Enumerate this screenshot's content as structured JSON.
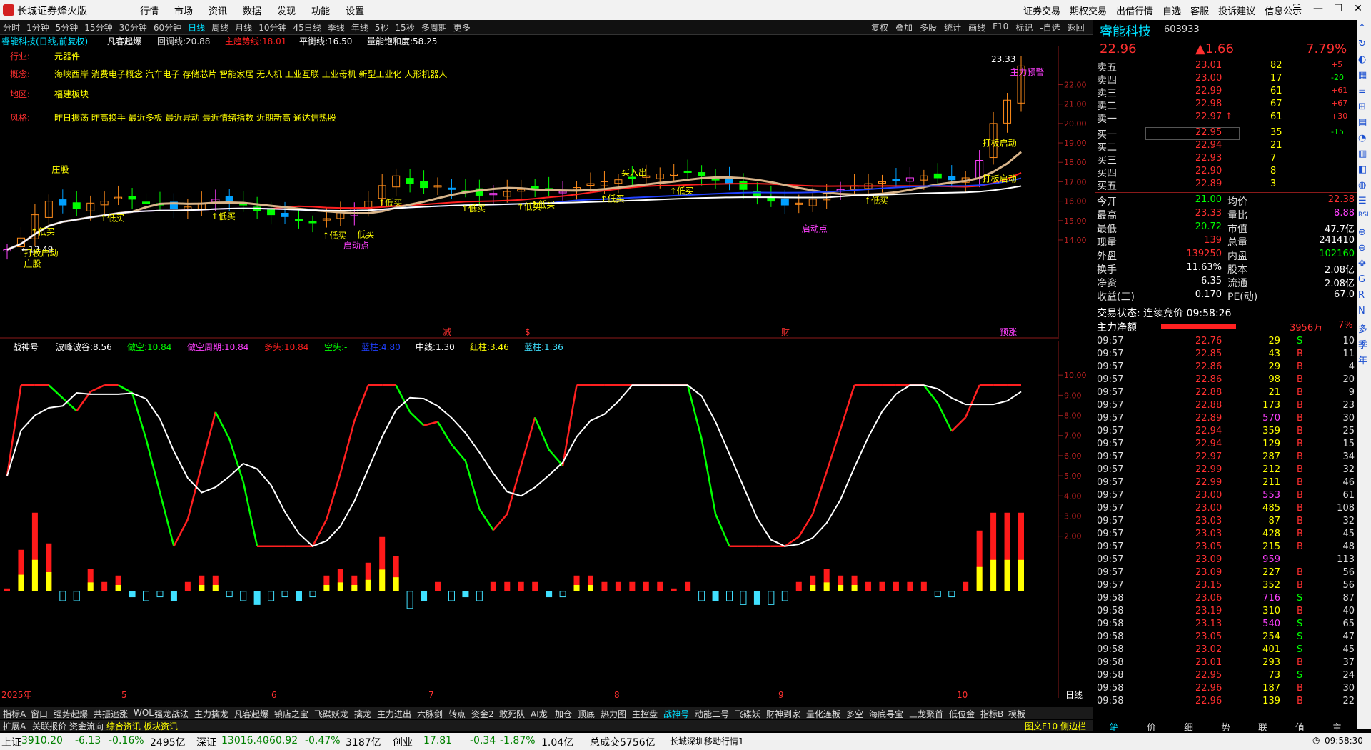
{
  "window": {
    "title": "长城证券烽火版",
    "menu": [
      "行情",
      "市场",
      "资讯",
      "数据",
      "发现",
      "功能",
      "设置"
    ],
    "right_menu": [
      "证券交易",
      "期权交易",
      "出借行情",
      "自选",
      "客服",
      "投诉建议",
      "信息公示"
    ]
  },
  "period_bar": {
    "items": [
      "分时",
      "1分钟",
      "5分钟",
      "15分钟",
      "30分钟",
      "60分钟",
      "日线",
      "周线",
      "月线",
      "10分钟",
      "45日线",
      "季线",
      "年线",
      "5秒",
      "15秒",
      "多周期",
      "更多"
    ],
    "active": "日线",
    "tools": [
      "复权",
      "叠加",
      "多股",
      "统计",
      "画线",
      "F10",
      "标记",
      "-自选",
      "返回"
    ]
  },
  "chart_header": {
    "stock": "睿能科技(日线,前复权)",
    "indicator": "凡客起爆",
    "items": [
      {
        "label": "回调线:",
        "value": "20.88",
        "color": "#dddddd"
      },
      {
        "label": "主趋势线:",
        "value": "18.01",
        "color": "#ff2020"
      },
      {
        "label": "平衡线:",
        "value": "16.50",
        "color": "#ffffff"
      },
      {
        "label": "量能饱和度:",
        "value": "58.25",
        "color": "#ffffff"
      }
    ]
  },
  "stock_info": [
    {
      "key": "行业:",
      "value": "元器件"
    },
    {
      "key": "概念:",
      "value": "海峡西岸 消费电子概念 汽车电子 存储芯片 智能家居 无人机 工业互联 工业母机 新型工业化 人形机器人"
    },
    {
      "key": "地区:",
      "value": "福建板块"
    },
    {
      "key": "风格:",
      "value": "昨日振荡 昨高换手 最近多板 最近异动 最近情绪指数 近期新高 通达信热股"
    }
  ],
  "main_chart": {
    "price_ticks": [
      "22.00",
      "21.00",
      "20.00",
      "19.00",
      "18.00",
      "17.00",
      "16.00",
      "15.00",
      "14.00"
    ],
    "high_label": "23.33",
    "low_label": "13.49",
    "markers": [
      "低买",
      "低买",
      "低买",
      "低买",
      "低买",
      "低买",
      "低买",
      "低买",
      "低买",
      "低买",
      "低买"
    ],
    "events": [
      "打板启动",
      "庄股",
      "庄股",
      "低买",
      "启动点",
      "启动点",
      "打板启动",
      "打板启动",
      "主力预警",
      "买入出"
    ],
    "date_marks": [
      "减",
      "$",
      "财",
      "预涨"
    ]
  },
  "sub_chart": {
    "name": "战神号",
    "items": [
      {
        "label": "波峰波谷:",
        "value": "8.56",
        "color": "#ffffff"
      },
      {
        "label": "做空:",
        "value": "10.84",
        "color": "#00ff00"
      },
      {
        "label": "做空周期:",
        "value": "10.84",
        "color": "#ff40ff"
      },
      {
        "label": "多头:",
        "value": "10.84",
        "color": "#ff2020"
      },
      {
        "label": "空头:",
        "value": "-",
        "color": "#00ff00"
      },
      {
        "label": "蓝柱:",
        "value": "4.80",
        "color": "#2040ff"
      },
      {
        "label": "中线:",
        "value": "1.30",
        "color": "#ffffff"
      },
      {
        "label": "红柱:",
        "value": "3.46",
        "color": "#ffff00"
      },
      {
        "label": "蓝柱:",
        "value": "1.36",
        "color": "#40e0ff"
      }
    ],
    "ticks": [
      "10.00",
      "9.00",
      "8.00",
      "7.00",
      "6.00",
      "5.00",
      "4.00",
      "3.00",
      "2.00"
    ]
  },
  "x_axis": {
    "labels": [
      "2025年",
      "5",
      "6",
      "7",
      "8",
      "9",
      "10"
    ],
    "period": "日线"
  },
  "tabs_row1": [
    "指标A",
    "窗口",
    "强势起爆",
    "共振追涨",
    "WOL",
    "强龙战法",
    "主力擒龙",
    "凡客起爆",
    "镇店之宝",
    "飞碟妖龙",
    "擒龙",
    "主力进出",
    "六脉剑",
    "转点",
    "资金2",
    "敢死队",
    "AI龙",
    "加仓",
    "顶底",
    "热力图",
    "主控盘",
    "战神号",
    "动能二号",
    "飞碟妖",
    "财神到家",
    "量化连板",
    "多空",
    "海底寻宝",
    "三龙聚首",
    "低位金",
    "指标B",
    "模板"
  ],
  "tabs_row1_active": "战神号",
  "tabs_row2": [
    "扩展A",
    "关联报价",
    "资金流向",
    "综合资讯",
    "板块资讯"
  ],
  "tabs_row2_right": [
    "图文F10",
    "侧边栏"
  ],
  "quote": {
    "name": "睿能科技",
    "code": "603933",
    "price": "22.96",
    "change": "▲1.66",
    "pct": "7.79%",
    "asks": [
      {
        "label": "卖五",
        "price": "23.01",
        "vol": "82",
        "chg": "+5"
      },
      {
        "label": "卖四",
        "price": "23.00",
        "vol": "17",
        "chg": "-20"
      },
      {
        "label": "卖三",
        "price": "22.99",
        "vol": "61",
        "chg": "+61"
      },
      {
        "label": "卖二",
        "price": "22.98",
        "vol": "67",
        "chg": "+67"
      },
      {
        "label": "卖一",
        "price": "22.97 ↑",
        "vol": "61",
        "chg": "+30"
      }
    ],
    "bids": [
      {
        "label": "买一",
        "price": "22.95",
        "vol": "35",
        "chg": "-15"
      },
      {
        "label": "买二",
        "price": "22.94",
        "vol": "21",
        "chg": ""
      },
      {
        "label": "买三",
        "price": "22.93",
        "vol": "7",
        "chg": ""
      },
      {
        "label": "买四",
        "price": "22.90",
        "vol": "8",
        "chg": ""
      },
      {
        "label": "买五",
        "price": "22.89",
        "vol": "3",
        "chg": ""
      }
    ],
    "stats": [
      {
        "l1": "今开",
        "v1": "21.00",
        "c1": "#00ff00",
        "l2": "均价",
        "v2": "22.38",
        "c2": "#ff3030"
      },
      {
        "l1": "最高",
        "v1": "23.33",
        "c1": "#ff3030",
        "l2": "量比",
        "v2": "8.88",
        "c2": "#ff40ff"
      },
      {
        "l1": "最低",
        "v1": "20.72",
        "c1": "#00ff00",
        "l2": "市值",
        "v2": "47.7亿",
        "c2": "#ffffff"
      },
      {
        "l1": "现量",
        "v1": "139",
        "c1": "#ff3030",
        "l2": "总量",
        "v2": "241410",
        "c2": "#ffffff"
      },
      {
        "l1": "外盘",
        "v1": "139250",
        "c1": "#ff3030",
        "l2": "内盘",
        "v2": "102160",
        "c2": "#00ff00"
      },
      {
        "l1": "换手",
        "v1": "11.63%",
        "c1": "#ffffff",
        "l2": "股本",
        "v2": "2.08亿",
        "c2": "#ffffff"
      },
      {
        "l1": "净资",
        "v1": "6.35",
        "c1": "#ffffff",
        "l2": "流通",
        "v2": "2.08亿",
        "c2": "#ffffff"
      },
      {
        "l1": "收益(三)",
        "v1": "0.170",
        "c1": "#ffffff",
        "l2": "PE(动)",
        "v2": "67.0",
        "c2": "#ffffff"
      }
    ],
    "trade_status": "交易状态: 连续竞价 09:58:26",
    "net_flow_label": "主力净额",
    "net_flow_value": "3956万",
    "net_flow_pct": "7%"
  },
  "ticks": [
    {
      "t": "09:57",
      "p": "22.76",
      "v": "29",
      "d": "S",
      "n": "10"
    },
    {
      "t": "09:57",
      "p": "22.85",
      "v": "43",
      "d": "B",
      "n": "11"
    },
    {
      "t": "09:57",
      "p": "22.86",
      "v": "29",
      "d": "B",
      "n": "4"
    },
    {
      "t": "09:57",
      "p": "22.86",
      "v": "98",
      "d": "B",
      "n": "20"
    },
    {
      "t": "09:57",
      "p": "22.88",
      "v": "21",
      "d": "B",
      "n": "9"
    },
    {
      "t": "09:57",
      "p": "22.88",
      "v": "173",
      "d": "B",
      "n": "23"
    },
    {
      "t": "09:57",
      "p": "22.89",
      "v": "570",
      "d": "B",
      "n": "30"
    },
    {
      "t": "09:57",
      "p": "22.94",
      "v": "359",
      "d": "B",
      "n": "25"
    },
    {
      "t": "09:57",
      "p": "22.94",
      "v": "129",
      "d": "B",
      "n": "15"
    },
    {
      "t": "09:57",
      "p": "22.97",
      "v": "287",
      "d": "B",
      "n": "34"
    },
    {
      "t": "09:57",
      "p": "22.99",
      "v": "212",
      "d": "B",
      "n": "32"
    },
    {
      "t": "09:57",
      "p": "22.99",
      "v": "211",
      "d": "B",
      "n": "46"
    },
    {
      "t": "09:57",
      "p": "23.00",
      "v": "553",
      "d": "B",
      "n": "61"
    },
    {
      "t": "09:57",
      "p": "23.00",
      "v": "485",
      "d": "B",
      "n": "108"
    },
    {
      "t": "09:57",
      "p": "23.03",
      "v": "87",
      "d": "B",
      "n": "32"
    },
    {
      "t": "09:57",
      "p": "23.03",
      "v": "428",
      "d": "B",
      "n": "45"
    },
    {
      "t": "09:57",
      "p": "23.05",
      "v": "215",
      "d": "B",
      "n": "48"
    },
    {
      "t": "09:57",
      "p": "23.09",
      "v": "959",
      "d": "",
      "n": "113"
    },
    {
      "t": "09:57",
      "p": "23.09",
      "v": "227",
      "d": "B",
      "n": "56"
    },
    {
      "t": "09:57",
      "p": "23.15",
      "v": "352",
      "d": "B",
      "n": "56"
    },
    {
      "t": "09:58",
      "p": "23.06",
      "v": "716",
      "d": "S",
      "n": "87"
    },
    {
      "t": "09:58",
      "p": "23.19",
      "v": "310",
      "d": "B",
      "n": "40"
    },
    {
      "t": "09:58",
      "p": "23.13",
      "v": "540",
      "d": "S",
      "n": "65"
    },
    {
      "t": "09:58",
      "p": "23.05",
      "v": "254",
      "d": "S",
      "n": "47"
    },
    {
      "t": "09:58",
      "p": "23.02",
      "v": "401",
      "d": "S",
      "n": "45"
    },
    {
      "t": "09:58",
      "p": "23.01",
      "v": "293",
      "d": "B",
      "n": "37"
    },
    {
      "t": "09:58",
      "p": "22.95",
      "v": "73",
      "d": "S",
      "n": "24"
    },
    {
      "t": "09:58",
      "p": "22.96",
      "v": "187",
      "d": "B",
      "n": "30"
    },
    {
      "t": "09:58",
      "p": "22.96",
      "v": "139",
      "d": "B",
      "n": "22"
    }
  ],
  "right_tabs": [
    "笔",
    "价",
    "细",
    "势",
    "联",
    "值",
    "主"
  ],
  "status": {
    "sh_label": "上证",
    "sh_val": "3910.20",
    "sh_chg": "-6.13",
    "sh_pct": "-0.16%",
    "sh_amt": "2495亿",
    "sz_label": "深证",
    "sz_val": "13016.40",
    "sz_chg": "-60.92",
    "sz_pct": "-0.47%",
    "sz_amt": "3187亿",
    "cy_label": "创业",
    "cy_val": "17.81",
    "cy_chg": "-0.34",
    "cy_pct": "-1.87%",
    "cy_amt": "1.04亿",
    "total": "总成交5756亿",
    "feed": "长城深圳移动行情1",
    "time": "09:58:30"
  },
  "side_tools": [
    "⌃",
    "↻",
    "◐",
    "▦",
    "≡",
    "⊞",
    "▤",
    "◔",
    "▥",
    "◧",
    "◍",
    "☰",
    "RSI",
    "⊕",
    "⊖",
    "✥",
    "G",
    "R",
    "N",
    "多",
    "季",
    "年"
  ],
  "colors": {
    "up": "#ff3030",
    "down": "#00ff00",
    "accent": "#00e0ff",
    "yellow": "#ffff00",
    "magenta": "#ff40ff",
    "bg": "#000000"
  },
  "chart_data": {
    "type": "line",
    "y_ticks": [
      22,
      21,
      20,
      19,
      18,
      17,
      16,
      15,
      14
    ],
    "closes": [
      13.5,
      14.1,
      15.3,
      16.0,
      15.8,
      15.6,
      15.9,
      16.0,
      16.2,
      16.1,
      15.9,
      15.8,
      15.6,
      15.7,
      15.9,
      16.1,
      16.0,
      15.8,
      15.5,
      15.3,
      15.2,
      15.0,
      14.9,
      15.1,
      15.4,
      15.6,
      16.0,
      16.8,
      17.3,
      16.9,
      16.7,
      16.8,
      16.6,
      16.5,
      16.3,
      16.4,
      16.5,
      16.6,
      16.7,
      16.6,
      16.5,
      16.7,
      16.9,
      17.0,
      17.1,
      17.2,
      17.3,
      17.4,
      17.4,
      17.5,
      17.3,
      17.1,
      16.9,
      16.6,
      16.3,
      16.0,
      15.8,
      15.9,
      16.1,
      16.4,
      16.6,
      16.8,
      16.9,
      17.0,
      17.1,
      17.2,
      17.3,
      17.2,
      17.1,
      17.2,
      18.1,
      20.0,
      21.2,
      22.96
    ]
  }
}
